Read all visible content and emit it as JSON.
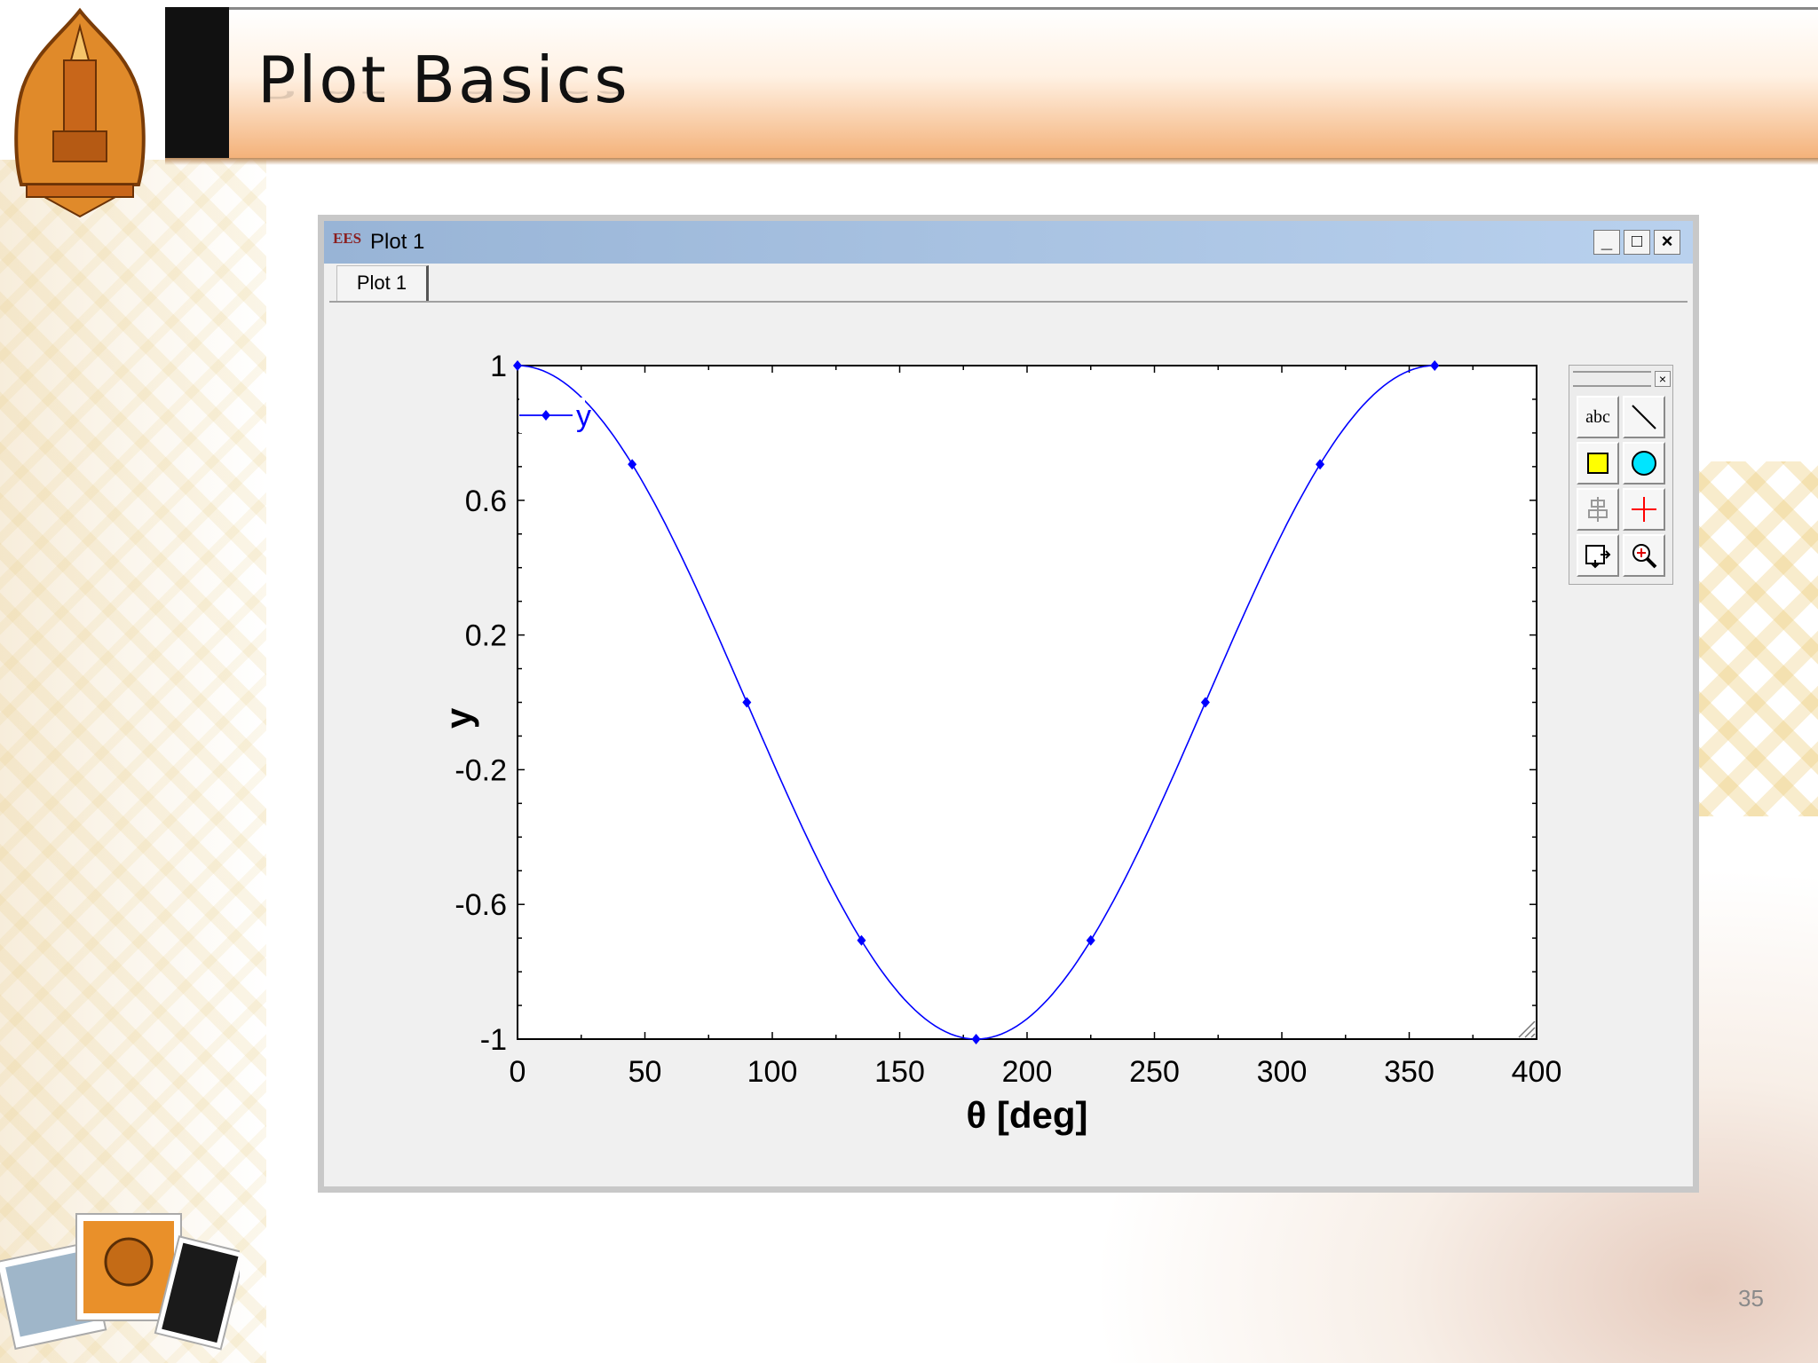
{
  "slide": {
    "title": "Plot Basics",
    "page_number": "35"
  },
  "window": {
    "app_icon": "EES",
    "title": "Plot 1",
    "tab_label": "Plot 1",
    "controls": {
      "minimize": "_",
      "maximize": "□",
      "close": "×"
    }
  },
  "palette": {
    "close": "×",
    "tools": [
      {
        "icon": "text-tool-icon",
        "label": "abc"
      },
      {
        "icon": "line-tool-icon"
      },
      {
        "icon": "rectangle-tool-icon",
        "color": "#ffff00"
      },
      {
        "icon": "ellipse-tool-icon",
        "color": "#00e5ff"
      },
      {
        "icon": "align-tool-icon"
      },
      {
        "icon": "crosshair-tool-icon",
        "color": "#ff0000"
      },
      {
        "icon": "copy-plot-icon"
      },
      {
        "icon": "zoom-tool-icon"
      }
    ]
  },
  "chart_data": {
    "type": "line",
    "title": "",
    "xlabel": "θ  [deg]",
    "ylabel": "y",
    "xlim": [
      0,
      400
    ],
    "ylim": [
      -1,
      1
    ],
    "x_ticks": [
      "0",
      "50",
      "100",
      "150",
      "200",
      "250",
      "300",
      "350",
      "400"
    ],
    "y_ticks": [
      "1",
      "0.6",
      "0.2",
      "-0.2",
      "-0.6",
      "-1"
    ],
    "legend": {
      "position": "top-left",
      "entries": [
        "y"
      ]
    },
    "series": [
      {
        "name": "y",
        "color": "#0000ff",
        "function": "cos(theta)",
        "markers_x": [
          0,
          45,
          90,
          135,
          180,
          225,
          270,
          315,
          360
        ],
        "markers_y": [
          1,
          0.707,
          0,
          -0.707,
          -1,
          -0.707,
          0,
          0.707,
          1
        ]
      }
    ]
  }
}
